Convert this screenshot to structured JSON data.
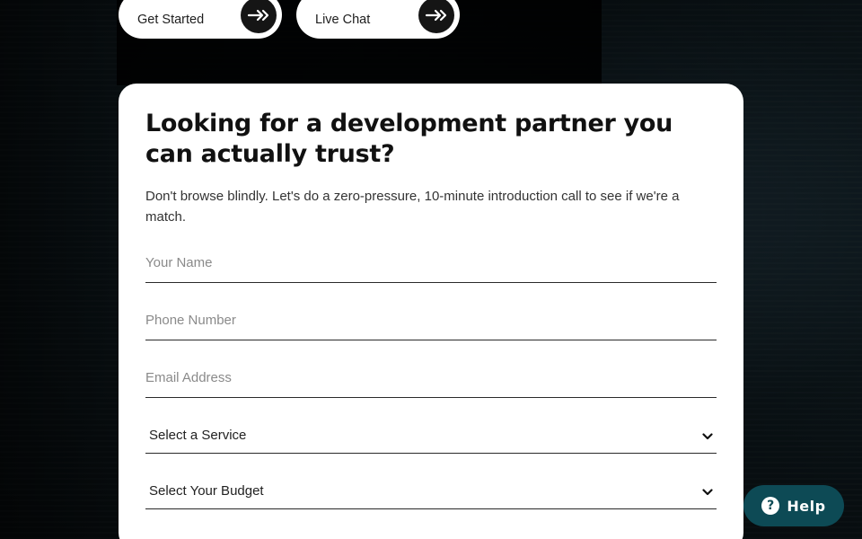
{
  "cta": {
    "get_started_label": "Get Started",
    "live_chat_label": "Live Chat"
  },
  "form": {
    "heading": "Looking for a development partner you can actually trust?",
    "intro": "Don't browse blindly. Let's do a zero-pressure, 10-minute introduction call to see if we're a match.",
    "name_placeholder": "Your Name",
    "phone_placeholder": "Phone Number",
    "email_placeholder": "Email Address",
    "service_select": "Select a Service",
    "budget_select": "Select Your Budget"
  },
  "help": {
    "label": "Help",
    "icon_glyph": "?"
  },
  "colors": {
    "help_bg": "#0d4a55",
    "card_bg": "#ffffff",
    "arrow_circle": "#151515"
  },
  "icons": {
    "arrow": "arrow-right-icon",
    "chevron": "chevron-down-icon",
    "help": "question-circle-icon"
  }
}
